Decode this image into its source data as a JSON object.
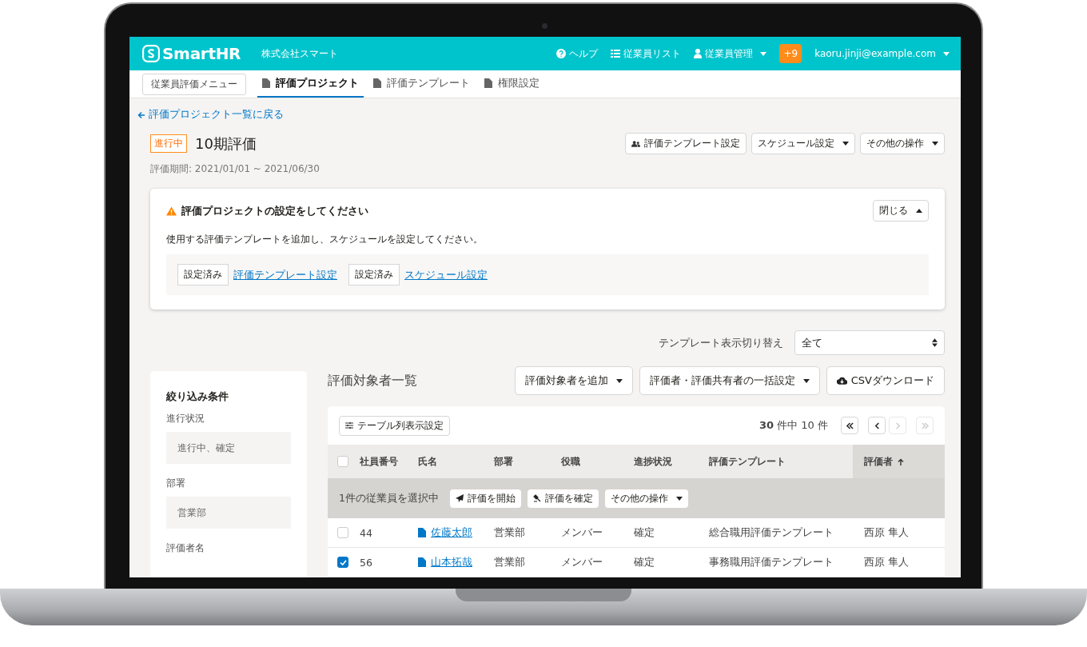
{
  "header": {
    "logo": "SmartHR",
    "company": "株式会社スマート",
    "links": [
      {
        "kind": "help",
        "label": "ヘルプ",
        "dropdown": false
      },
      {
        "kind": "list",
        "label": "従業員リスト",
        "dropdown": false
      },
      {
        "kind": "user",
        "label": "従業員管理",
        "dropdown": true
      }
    ],
    "badge": "+9",
    "account": "kaoru.jinji@example.com"
  },
  "subnav": {
    "menu_button": "従業員評価メニュー",
    "tabs": [
      {
        "label": "評価プロジェクト",
        "selected": true
      },
      {
        "label": "評価テンプレート",
        "selected": false
      },
      {
        "label": "権限設定",
        "selected": false
      }
    ]
  },
  "project": {
    "back_link": "評価プロジェクト一覧に戻る",
    "status": "進行中",
    "title": "10期評価",
    "period": "評価期間: 2021/01/01 ~ 2021/06/30",
    "actions": [
      {
        "label": "評価テンプレート設定",
        "kind": "people"
      },
      {
        "label": "スケジュール設定",
        "kind": "dropdown"
      },
      {
        "label": "その他の操作",
        "kind": "dropdown"
      }
    ]
  },
  "alert": {
    "title": "評価プロジェクトの設定をしてください",
    "close_button": "閉じる",
    "message": "使用する評価テンプレートを追加し、スケジュールを設定してください。",
    "steps": [
      {
        "status": "設定済み",
        "link": "評価テンプレート設定"
      },
      {
        "status": "設定済み",
        "link": "スケジュール設定"
      }
    ]
  },
  "template_switch": {
    "label": "テンプレート表示切り替え",
    "value": "全て"
  },
  "filters": {
    "title": "絞り込み条件",
    "fields": [
      {
        "label": "進行状況",
        "value": "進行中、確定"
      },
      {
        "label": "部署",
        "value": "営業部"
      },
      {
        "label": "評価者名"
      }
    ]
  },
  "list": {
    "title": "評価対象者一覧",
    "actions": [
      {
        "label": "評価対象者を追加",
        "kind": "dropdown"
      },
      {
        "label": "評価者・評価共有者の一括設定",
        "kind": "dropdown"
      },
      {
        "label": "CSVダウンロード",
        "kind": "download"
      }
    ],
    "column_settings": "テーブル列表示設定",
    "count": "**30** 件中 10 件",
    "pagination": [
      {
        "kind": "first",
        "disabled": false
      },
      {
        "kind": "prev",
        "disabled": false
      },
      {
        "kind": "next",
        "disabled": true
      },
      {
        "kind": "last",
        "disabled": true
      }
    ],
    "header_checked": false,
    "columns": [
      {
        "label": "社員番号",
        "sorted": false
      },
      {
        "label": "氏名",
        "sorted": false
      },
      {
        "label": "部署",
        "sorted": false
      },
      {
        "label": "役職",
        "sorted": false
      },
      {
        "label": "進捗状況",
        "sorted": false
      },
      {
        "label": "評価テンプレート",
        "sorted": false
      },
      {
        "label": "評価者",
        "sorted": true
      }
    ],
    "selection": {
      "text": "1件の従業員を選択中",
      "actions": [
        {
          "label": "評価を開始",
          "kind": "send"
        },
        {
          "label": "評価を確定",
          "kind": "stamp"
        },
        {
          "label": "その他の操作",
          "kind": "dropdown"
        }
      ]
    },
    "rows": [
      {
        "checked": false,
        "cells": [
          "44",
          "佐藤太郎",
          "営業部",
          "メンバー",
          "確定",
          "総合職用評価テンプレート",
          "西原 隼人"
        ]
      },
      {
        "checked": true,
        "cells": [
          "56",
          "山本拓哉",
          "営業部",
          "メンバー",
          "確定",
          "事務職用評価テンプレート",
          "西原 隼人"
        ]
      }
    ]
  }
}
